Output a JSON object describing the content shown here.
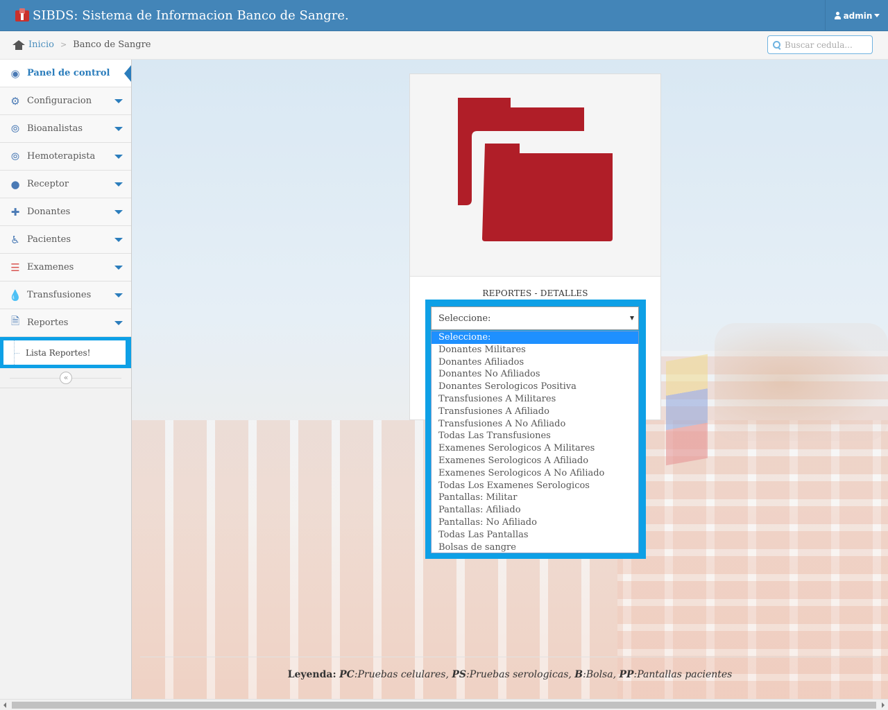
{
  "navbar": {
    "title": "SIBDS: Sistema de Informacion Banco de Sangre.",
    "user": "admin"
  },
  "breadcrumb": {
    "home": "Inicio",
    "current": "Banco de Sangre"
  },
  "search": {
    "placeholder": "Buscar cedula..."
  },
  "sidebar": {
    "items": [
      {
        "label": "Panel de control",
        "icon": "dashboard-icon"
      },
      {
        "label": "Configuracion",
        "icon": "gear-icon"
      },
      {
        "label": "Bioanalistas",
        "icon": "stethoscope-icon"
      },
      {
        "label": "Hemoterapista",
        "icon": "stethoscope-icon"
      },
      {
        "label": "Receptor",
        "icon": "user-icon"
      },
      {
        "label": "Donantes",
        "icon": "user-plus-icon"
      },
      {
        "label": "Pacientes",
        "icon": "wheelchair-icon"
      },
      {
        "label": "Examenes",
        "icon": "list-icon"
      },
      {
        "label": "Transfusiones",
        "icon": "drop-icon"
      },
      {
        "label": "Reportes",
        "icon": "pdf-file-icon"
      }
    ],
    "submenu": "Lista Reportes!"
  },
  "panel": {
    "title": "REPORTES - DETALLES",
    "image_icon": "folders-icon",
    "select_value": "Seleccione:",
    "options": [
      "Seleccione:",
      "Donantes Militares",
      "Donantes Afiliados",
      "Donantes No Afiliados",
      "Donantes Serologicos Positiva",
      "Transfusiones A Militares",
      "Transfusiones A Afiliado",
      "Transfusiones A No Afiliado",
      "Todas Las Transfusiones",
      "Examenes Serologicos A Militares",
      "Examenes Serologicos A Afiliado",
      "Examenes Serologicos A No Afiliado",
      "Todas Los Examenes Serologicos",
      "Pantallas: Militar",
      "Pantallas: Afiliado",
      "Pantallas: No Afiliado",
      "Todas Las Pantallas",
      "Bolsas de sangre"
    ]
  },
  "legend": {
    "label": "Leyenda:",
    "pc_key": "PC",
    "pc_text": ":Pruebas celulares, ",
    "ps_key": "PS",
    "ps_text": ":Pruebas serologicas, ",
    "b_key": "B",
    "b_text": ":Bolsa, ",
    "pp_key": "PP",
    "pp_text": ":Pantallas pacientes"
  },
  "colors": {
    "navbar": "#4385b8",
    "accent": "#2b7dbc",
    "highlight": "#0ea0e6",
    "folder": "#b01e28"
  }
}
